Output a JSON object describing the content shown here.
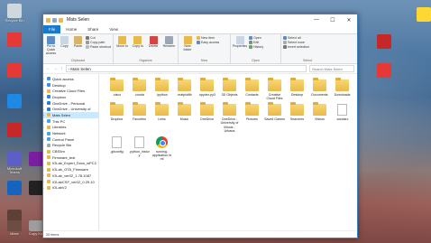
{
  "window": {
    "title": "Mats Selen",
    "controls": [
      "—",
      "☐",
      "✕"
    ]
  },
  "tabs": [
    "File",
    "Home",
    "Share",
    "View"
  ],
  "ribbon": {
    "clipboard": {
      "label": "Clipboard",
      "pin": "Pin to Quick access",
      "copy": "Copy",
      "paste": "Paste",
      "cut": "Cut",
      "copy_path": "Copy path",
      "paste_shortcut": "Paste shortcut"
    },
    "organize": {
      "label": "Organize",
      "move_to": "Move to",
      "copy_to": "Copy to",
      "delete": "Delete",
      "rename": "Rename"
    },
    "new": {
      "label": "New",
      "new_folder": "New folder",
      "new_item": "New item",
      "easy_access": "Easy access"
    },
    "open": {
      "label": "Open",
      "properties": "Properties",
      "open": "Open",
      "edit": "Edit",
      "history": "History"
    },
    "select": {
      "label": "Select",
      "select_all": "Select all",
      "select_none": "Select none",
      "invert": "Invert selection"
    }
  },
  "address": {
    "path": "› Mats Selen",
    "search_placeholder": "Search Mats Selen"
  },
  "nav_pane": [
    {
      "label": "Quick access",
      "color": "#3a8ee6",
      "chev": "›"
    },
    {
      "label": "Desktop",
      "color": "#3a8ee6",
      "chev": "⌄"
    },
    {
      "label": "Creative Cloud Files",
      "color": "#e8b84a",
      "chev": "›"
    },
    {
      "label": "Dropbox",
      "color": "#2d7ff9",
      "chev": "›"
    },
    {
      "label": "OneDrive - Personal",
      "color": "#2b7cd3",
      "chev": "›"
    },
    {
      "label": "OneDrive - University of",
      "color": "#2b7cd3",
      "chev": "›"
    },
    {
      "label": "Mats Selen",
      "color": "#e8b84a",
      "chev": "›",
      "selected": true
    },
    {
      "label": "This PC",
      "color": "#4aa3df",
      "chev": "›"
    },
    {
      "label": "Libraries",
      "color": "#e8b84a",
      "chev": "›"
    },
    {
      "label": "Network",
      "color": "#4aa3df",
      "chev": "›"
    },
    {
      "label": "Control Panel",
      "color": "#4aa3df",
      "chev": "›"
    },
    {
      "label": "Recycle Bin",
      "color": "#9aa",
      "chev": ""
    },
    {
      "label": "CBS5m",
      "color": "#e8b84a",
      "chev": ""
    },
    {
      "label": "Firmware_test",
      "color": "#e8b84a",
      "chev": ""
    },
    {
      "label": "IOLab_Expert_Docs_wPC2",
      "color": "#e8b84a",
      "chev": ""
    },
    {
      "label": "IOLab_OTA_Firmware",
      "color": "#e8b84a",
      "chev": "›"
    },
    {
      "label": "IOLab_ver02_1.78.1087",
      "color": "#e8b84a",
      "chev": "›"
    },
    {
      "label": "IOLabCSF_ver02_0.29.10",
      "color": "#e8b84a",
      "chev": "›"
    },
    {
      "label": "IOLabV2",
      "color": "#e8b84a",
      "chev": "›"
    }
  ],
  "items": [
    {
      "label": ".cisco",
      "type": "folder"
    },
    {
      "label": ".conda",
      "type": "folder"
    },
    {
      "label": ".ipython",
      "type": "folder"
    },
    {
      "label": ".matplotlib",
      "type": "folder"
    },
    {
      "label": ".spyder-py3",
      "type": "folder"
    },
    {
      "label": "3D Objects",
      "type": "folder"
    },
    {
      "label": "Contacts",
      "type": "folder"
    },
    {
      "label": "Creative Cloud Files",
      "type": "folder"
    },
    {
      "label": "Desktop",
      "type": "folder"
    },
    {
      "label": "Documents",
      "type": "folder"
    },
    {
      "label": "Downloads",
      "type": "folder"
    },
    {
      "label": "Dropbox",
      "type": "folder"
    },
    {
      "label": "Favorites",
      "type": "folder"
    },
    {
      "label": "Links",
      "type": "folder"
    },
    {
      "label": "Music",
      "type": "folder"
    },
    {
      "label": "OneDrive",
      "type": "folder"
    },
    {
      "label": "OneDrive - University of Illinois - Urbana",
      "type": "folder"
    },
    {
      "label": "Pictures",
      "type": "folder"
    },
    {
      "label": "Saved Games",
      "type": "folder"
    },
    {
      "label": "Searches",
      "type": "folder"
    },
    {
      "label": "Videos",
      "type": "folder"
    },
    {
      "label": ".condarc",
      "type": "doc"
    },
    {
      "label": ".gitconfig",
      "type": "doc"
    },
    {
      "label": ".python_history",
      "type": "doc"
    },
    {
      "label": "running-application.html",
      "type": "chrome"
    }
  ],
  "status": "25 items",
  "desktop_icons": [
    {
      "label": "Recycle Bin",
      "color": "#cfd8dc"
    },
    {
      "label": "",
      "color": "#e53935"
    },
    {
      "label": "",
      "color": "#e53935"
    },
    {
      "label": "",
      "color": "#1e88e5"
    },
    {
      "label": "",
      "color": "#c62828"
    },
    {
      "label": "Microsoft Teams",
      "color": "#5b5fc7"
    },
    {
      "label": "",
      "color": "#1565c0"
    },
    {
      "label": "",
      "color": "#7b1fa2"
    },
    {
      "label": "",
      "color": "#222"
    },
    {
      "label": "",
      "color": "#5d4037"
    }
  ],
  "desktop_right_icons": [
    {
      "label": "",
      "color": "#fdd835"
    },
    {
      "label": "",
      "color": "#c62828"
    },
    {
      "label": "",
      "color": "#e53935"
    }
  ],
  "desktop_bottom_labels": [
    "Mixer",
    "Copy Kid"
  ]
}
